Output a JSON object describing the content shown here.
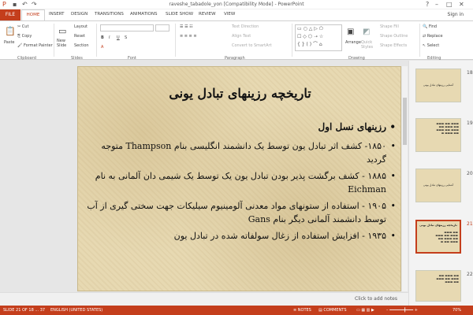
{
  "window": {
    "title": "raveshe_tabadole_yon [Compatibility Mode] - PowerPoint",
    "signin": "Sign in"
  },
  "tabs": [
    "FILE",
    "HOME",
    "INSERT",
    "DESIGN",
    "TRANSITIONS",
    "ANIMATIONS",
    "SLIDE SHOW",
    "REVIEW",
    "VIEW"
  ],
  "ribbon": {
    "clipboard": {
      "paste": "Paste",
      "cut": "Cut",
      "copy": "Copy",
      "format_painter": "Format Painter",
      "group": "Clipboard"
    },
    "slides": {
      "new_slide": "New Slide",
      "layout": "Layout",
      "reset": "Reset",
      "section": "Section",
      "group": "Slides"
    },
    "font": {
      "group": "Font"
    },
    "paragraph": {
      "text_direction": "Text Direction",
      "align_text": "Align Text",
      "convert": "Convert to SmartArt",
      "group": "Paragraph"
    },
    "drawing": {
      "arrange": "Arrange",
      "quick_styles": "Quick Styles",
      "shape_fill": "Shape Fill",
      "shape_outline": "Shape Outline",
      "shape_effects": "Shape Effects",
      "group": "Drawing"
    },
    "editing": {
      "find": "Find",
      "replace": "Replace",
      "select": "Select",
      "group": "Editing"
    }
  },
  "slide": {
    "title": "تاریخچه رزینهای تبادل یونی",
    "bullets": [
      "رزینهای نسل اول",
      "۱۸۵۰- کشف اثر تبادل یون توسط یک دانشمند انگلیسی بنام Thampson متوجه گردید",
      "۱۸۸۵ - کشف برگشت پذیر بودن تبادل یون یک توسط یک شیمی دان آلمانی به نام Eichman",
      "۱۹۰۵ - استفاده از ستونهای مواد معدنی آلومینیوم سیلیکات جهت سختی گیری از آب توسط دانشمند آلمانی دیگر بنام Gans",
      "۱۹۳۵ - افزایش استفاده از زغال سولفاته شده در تبادل یون"
    ]
  },
  "notes_placeholder": "Click to add notes",
  "thumbnails": [
    {
      "num": "18",
      "text": "آشنایی رزینهای تبادل یونی"
    },
    {
      "num": "19",
      "text": ""
    },
    {
      "num": "20",
      "text": "آشنایی رزینهای تبادل یونی"
    },
    {
      "num": "21",
      "text": "تاریخچه رزینهای تبادل یونی"
    },
    {
      "num": "22",
      "text": ""
    }
  ],
  "status": {
    "slide": "SLIDE 21 OF 18 ... 37",
    "language": "ENGLISH (UNITED STATES)",
    "notes": "NOTES",
    "comments": "COMMENTS",
    "zoom": "70%"
  }
}
